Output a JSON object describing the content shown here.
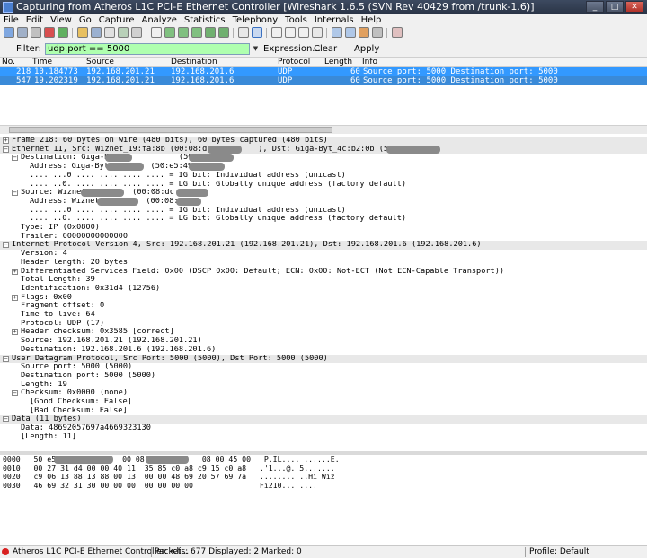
{
  "window": {
    "title": "Capturing from Atheros L1C PCI-E Ethernet Controller   [Wireshark 1.6.5  (SVN Rev 40429 from /trunk-1.6)]"
  },
  "menu": [
    "File",
    "Edit",
    "View",
    "Go",
    "Capture",
    "Analyze",
    "Statistics",
    "Telephony",
    "Tools",
    "Internals",
    "Help"
  ],
  "filter": {
    "label": "Filter:",
    "value": "udp.port == 5000",
    "expression": "Expression...",
    "clear": "Clear",
    "apply": "Apply"
  },
  "columns": [
    "No.",
    "Time",
    "Source",
    "Destination",
    "Protocol",
    "Length",
    "Info"
  ],
  "packets": [
    {
      "no": "218",
      "time": "10.184773",
      "src": "192.168.201.21",
      "dst": "192.168.201.6",
      "proto": "UDP",
      "len": "60",
      "info": "Source port: 5000  Destination port: 5000"
    },
    {
      "no": "547",
      "time": "19.202319",
      "src": "192.168.201.21",
      "dst": "192.168.201.6",
      "proto": "UDP",
      "len": "60",
      "info": "Source port: 5000  Destination port: 5000"
    }
  ],
  "details": [
    {
      "lvl": 0,
      "t": "+",
      "text": "Frame 218: 60 bytes on wire (480 bits), 60 bytes captured (480 bits)",
      "hdr": true
    },
    {
      "lvl": 0,
      "t": "-",
      "text": "Ethernet II, Src: Wiznet_19:fa:8b (00:08:dc:         ), Dst: Giga-Byt_4c:b2:0b (50:e5:49",
      "hdr": true
    },
    {
      "lvl": 1,
      "t": "-",
      "text": "Destination: Giga-Byt_            (50:e5:49"
    },
    {
      "lvl": 2,
      "t": "",
      "text": "Address: Giga-Byt_        (50:e5:49"
    },
    {
      "lvl": 2,
      "t": "",
      "text": ".... ...0 .... .... .... .... = IG bit: Individual address (unicast)"
    },
    {
      "lvl": 2,
      "t": "",
      "text": ".... ..0. .... .... .... .... = LG bit: Globally unique address (factory default)"
    },
    {
      "lvl": 1,
      "t": "-",
      "text": "Source: Wiznet_         (00:08:dc"
    },
    {
      "lvl": 2,
      "t": "",
      "text": "Address: Wiznet_         (00:08:dc"
    },
    {
      "lvl": 2,
      "t": "",
      "text": ".... ...0 .... .... .... .... = IG bit: Individual address (unicast)"
    },
    {
      "lvl": 2,
      "t": "",
      "text": ".... ..0. .... .... .... .... = LG bit: Globally unique address (factory default)"
    },
    {
      "lvl": 1,
      "t": "",
      "text": "Type: IP (0x0800)"
    },
    {
      "lvl": 1,
      "t": "",
      "text": "Trailer: 00000000000000"
    },
    {
      "lvl": 0,
      "t": "-",
      "text": "Internet Protocol Version 4, Src: 192.168.201.21 (192.168.201.21), Dst: 192.168.201.6 (192.168.201.6)",
      "hdr": true
    },
    {
      "lvl": 1,
      "t": "",
      "text": "Version: 4"
    },
    {
      "lvl": 1,
      "t": "",
      "text": "Header length: 20 bytes"
    },
    {
      "lvl": 1,
      "t": "+",
      "text": "Differentiated Services Field: 0x00 (DSCP 0x00: Default; ECN: 0x00: Not-ECT (Not ECN-Capable Transport))"
    },
    {
      "lvl": 1,
      "t": "",
      "text": "Total Length: 39"
    },
    {
      "lvl": 1,
      "t": "",
      "text": "Identification: 0x31d4 (12756)"
    },
    {
      "lvl": 1,
      "t": "+",
      "text": "Flags: 0x00"
    },
    {
      "lvl": 1,
      "t": "",
      "text": "Fragment offset: 0"
    },
    {
      "lvl": 1,
      "t": "",
      "text": "Time to live: 64"
    },
    {
      "lvl": 1,
      "t": "",
      "text": "Protocol: UDP (17)"
    },
    {
      "lvl": 1,
      "t": "+",
      "text": "Header checksum: 0x3585 [correct]"
    },
    {
      "lvl": 1,
      "t": "",
      "text": "Source: 192.168.201.21 (192.168.201.21)"
    },
    {
      "lvl": 1,
      "t": "",
      "text": "Destination: 192.168.201.6 (192.168.201.6)"
    },
    {
      "lvl": 0,
      "t": "-",
      "text": "User Datagram Protocol, Src Port: 5000 (5000), Dst Port: 5000 (5000)",
      "hdr": true
    },
    {
      "lvl": 1,
      "t": "",
      "text": "Source port: 5000 (5000)"
    },
    {
      "lvl": 1,
      "t": "",
      "text": "Destination port: 5000 (5000)"
    },
    {
      "lvl": 1,
      "t": "",
      "text": "Length: 19"
    },
    {
      "lvl": 1,
      "t": "-",
      "text": "Checksum: 0x0000 (none)"
    },
    {
      "lvl": 2,
      "t": "",
      "text": "[Good Checksum: False]"
    },
    {
      "lvl": 2,
      "t": "",
      "text": "[Bad Checksum: False]"
    },
    {
      "lvl": 0,
      "t": "-",
      "text": "Data (11 bytes)",
      "hdr": true
    },
    {
      "lvl": 1,
      "t": "",
      "text": "Data: 48692057697a4669323130"
    },
    {
      "lvl": 1,
      "t": "",
      "text": "[Length: 11]"
    }
  ],
  "bytes": [
    "0000   50 e5 49            00 08  dc         08 00 45 00   P.IL.... ......E.",
    "0010   00 27 31 d4 00 00 40 11  35 85 c0 a8 c9 15 c0 a8   .'1...@. 5.......",
    "0020   c9 06 13 88 13 88 00 13  00 00 48 69 20 57 69 7a   ........ ..Hi Wiz",
    "0030   46 69 32 31 30 00 00 00  00 00 00 00               Fi210... ...."
  ],
  "status": {
    "left": "Atheros L1C PCI-E Ethernet Controller: <li...",
    "middle": "Packets: 677 Displayed: 2 Marked: 0",
    "right": "Profile: Default"
  }
}
